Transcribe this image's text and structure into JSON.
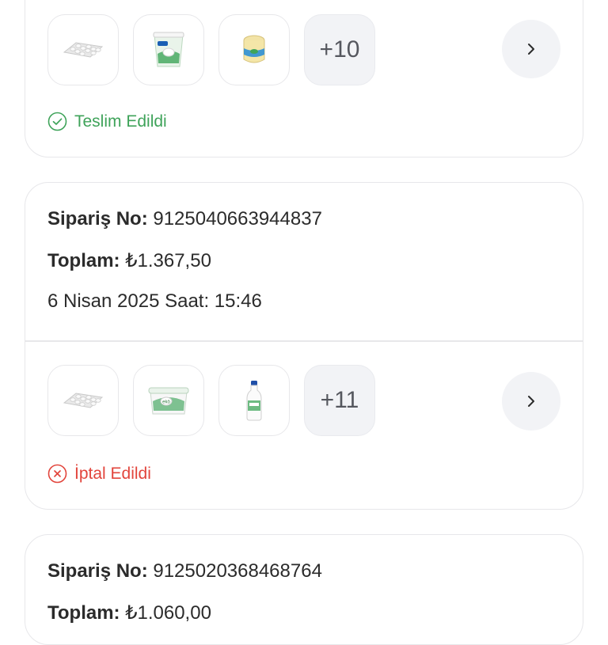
{
  "orders": [
    {
      "items_more": "+10",
      "status": "Teslim Edildi",
      "status_color": "#3fa35a",
      "products": [
        "egg-tray-icon",
        "yogurt-tub-icon",
        "cheese-jar-icon"
      ]
    },
    {
      "order_no_label": "Sipariş No:",
      "order_no": "9125040663944837",
      "total_label": "Toplam:",
      "total": "₺1.367,50",
      "date": "6 Nisan 2025 Saat: 15:46",
      "items_more": "+11",
      "status": "İptal Edildi",
      "status_color": "#e2453c",
      "products": [
        "egg-tray-icon",
        "cheese-box-icon",
        "milk-bottle-icon"
      ]
    },
    {
      "order_no_label": "Sipariş No:",
      "order_no": "9125020368468764",
      "total_label": "Toplam:",
      "total": "₺1.060,00"
    }
  ]
}
